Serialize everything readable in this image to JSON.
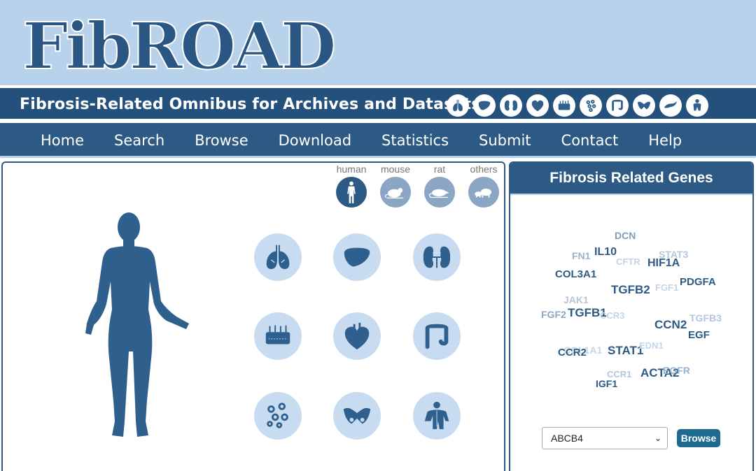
{
  "header": {
    "logo_text": "FibROAD",
    "tagline": "Fibrosis-Related Omnibus for Archives and Datasets",
    "organ_icons": [
      "lung-icon",
      "liver-icon",
      "kidney-icon",
      "heart-icon",
      "skin-icon",
      "cells-icon",
      "intestine-icon",
      "pelvis-icon",
      "pancreas-icon",
      "muscle-icon"
    ]
  },
  "nav": {
    "items": [
      "Home",
      "Search",
      "Browse",
      "Download",
      "Statistics",
      "Submit",
      "Contact",
      "Help"
    ]
  },
  "species": [
    {
      "label": "human",
      "icon": "human-icon",
      "active": true
    },
    {
      "label": "mouse",
      "icon": "mouse-icon",
      "active": false
    },
    {
      "label": "rat",
      "icon": "rat-icon",
      "active": false
    },
    {
      "label": "others",
      "icon": "others-icon",
      "active": false
    }
  ],
  "organs": [
    "lung-icon",
    "liver-icon",
    "kidney-icon",
    "skin-icon",
    "heart-icon",
    "intestine-icon",
    "cells-icon",
    "pelvis-icon",
    "muscle-icon"
  ],
  "genes_panel": {
    "title": "Fibrosis Related Genes",
    "words": [
      "DCN",
      "FN1",
      "IL10",
      "CFTR",
      "STAT3",
      "HIF1A",
      "COL3A1",
      "TGFB2",
      "FGF1",
      "PDGFA",
      "JAK1",
      "FGF2",
      "TGFB1",
      "CCR3",
      "TGFB3",
      "CCN2",
      "EGF",
      "COL1A1",
      "CCR2",
      "STAT1",
      "EDN1",
      "CCR1",
      "ACTA2",
      "EGFR",
      "IGF1"
    ],
    "select_value": "ABCB4",
    "browse_label": "Browse"
  },
  "colors": {
    "primary": "#2d5a85",
    "header_bg": "#b9d2ec",
    "organ_circle": "#c7dcf1",
    "organ_fill": "#2f5f8d",
    "browse_button": "#1f6a8f"
  }
}
